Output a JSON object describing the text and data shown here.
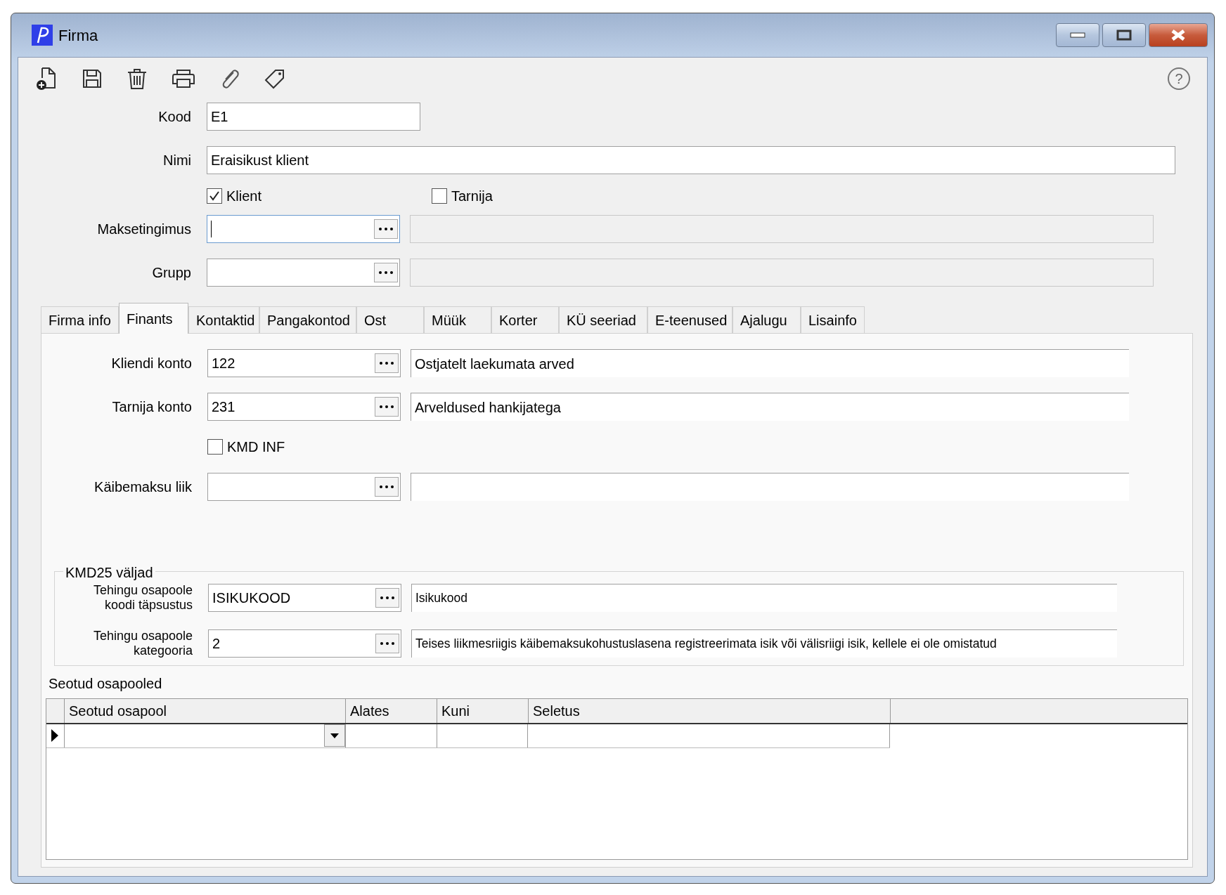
{
  "window": {
    "title": "Firma"
  },
  "toolbar": {
    "help": "?"
  },
  "header": {
    "kood": {
      "label": "Kood",
      "value": "E1"
    },
    "nimi": {
      "label": "Nimi",
      "value": "Eraisikust klient"
    },
    "checkboxes": [
      {
        "label": "Klient",
        "checked": true
      },
      {
        "label": "Tarnija",
        "checked": false
      }
    ],
    "lookups": [
      {
        "label": "Maksetingimus",
        "focused": true
      },
      {
        "label": "Grupp",
        "focused": false
      }
    ]
  },
  "tabs": [
    {
      "label": "Firma info",
      "selected": false
    },
    {
      "label": "Finants",
      "selected": true
    },
    {
      "label": "Kontaktid",
      "selected": false
    },
    {
      "label": "Pangakontod",
      "selected": false
    },
    {
      "label": "Ost",
      "selected": false
    },
    {
      "label": "Müük",
      "selected": false
    },
    {
      "label": "Korter",
      "selected": false
    },
    {
      "label": "KÜ seeriad",
      "selected": false
    },
    {
      "label": "E-teenused",
      "selected": false
    },
    {
      "label": "Ajalugu",
      "selected": false
    },
    {
      "label": "Lisainfo",
      "selected": false
    }
  ],
  "finants": {
    "accounts": [
      {
        "label": "Kliendi konto",
        "value": "122",
        "description": "Ostjatelt laekumata arved"
      },
      {
        "label": "Tarnija konto",
        "value": "231",
        "description": "Arveldused hankijatega"
      }
    ],
    "kmd_inf": {
      "label": "KMD INF",
      "checked": false
    },
    "kaibemaksu_liik": {
      "label": "Käibemaksu liik"
    },
    "kmd25": {
      "title": "KMD25 väljad",
      "rows": [
        {
          "label": "Tehingu osapoole\nkoodi täpsustus",
          "value": "ISIKUKOOD",
          "description": "Isikukood"
        },
        {
          "label": "Tehingu osapoole\nkategooria",
          "value": "2",
          "description": "Teises liikmesriigis käibemaksukohustuslasena registreerimata isik või välisriigi isik, kellele ei ole omistatud"
        }
      ]
    },
    "related": {
      "title": "Seotud osapooled",
      "columns": [
        "Seotud osapool",
        "Alates",
        "Kuni",
        "Seletus"
      ]
    }
  }
}
